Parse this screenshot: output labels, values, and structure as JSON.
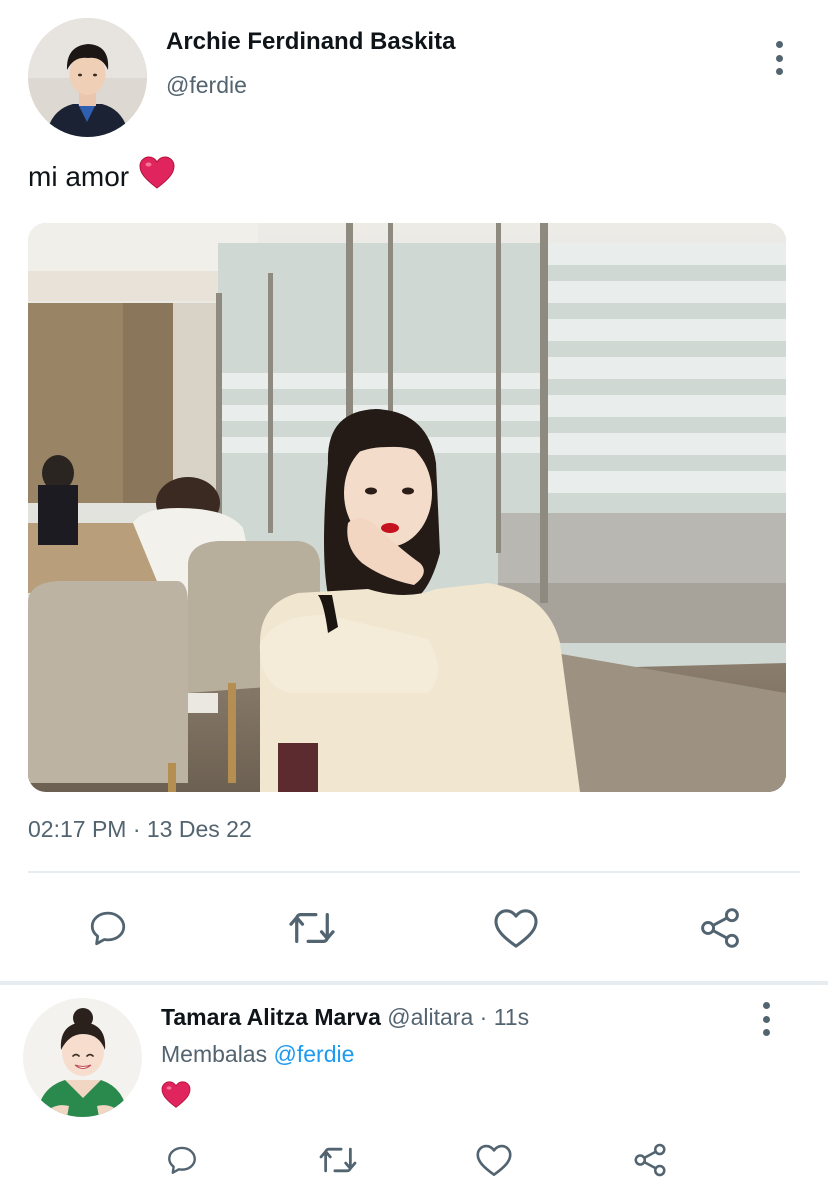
{
  "tweet": {
    "author_name": "Archie Ferdinand Baskita",
    "author_handle": "@ferdie",
    "text": "mi amor",
    "emoji": "red-heart-emoji",
    "timestamp": "02:17 PM · 13 Des 22",
    "actions": [
      "reply-icon",
      "retweet-icon",
      "like-icon",
      "share-icon"
    ]
  },
  "reply": {
    "author_name": "Tamara Alitza Marva",
    "author_handle": "@alitara",
    "separator": "·",
    "time": "11s",
    "replying_to_label": "Membalas",
    "replying_to_handle": "@ferdie",
    "emoji": "red-heart-emoji",
    "actions": [
      "reply-icon",
      "retweet-icon",
      "like-icon",
      "share-icon"
    ]
  },
  "colors": {
    "text_primary": "#0f1419",
    "text_secondary": "#536471",
    "link": "#1d9bf0",
    "divider": "#e6ecf0",
    "heart": "#e0245e"
  }
}
